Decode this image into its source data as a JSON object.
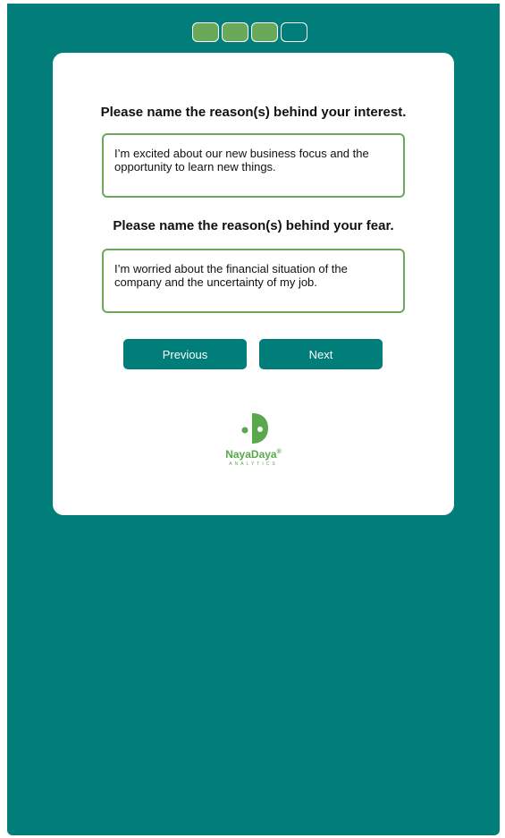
{
  "progress": {
    "steps": [
      "done",
      "done",
      "done",
      "todo"
    ]
  },
  "questions": [
    {
      "prompt": "Please name the reason(s) behind your interest.",
      "answer": "I’m excited about our new business focus and the opportunity to learn new things."
    },
    {
      "prompt": "Please name the reason(s) behind your fear.",
      "answer": "I’m worried about the financial situation of the company and the uncertainty of my job."
    }
  ],
  "buttons": {
    "previous": "Previous",
    "next": "Next"
  },
  "logo": {
    "name": "NayaDaya",
    "registered": "®",
    "subtitle": "ANALYTICS"
  },
  "colors": {
    "background": "#017e7a",
    "accent_green": "#6aa85a",
    "card": "#ffffff"
  }
}
